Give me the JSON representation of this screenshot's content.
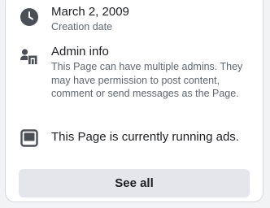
{
  "page_info": {
    "creation": {
      "date": "March 2, 2009",
      "label": "Creation date",
      "icon": "clock-icon"
    },
    "admin": {
      "title": "Admin info",
      "description": "This Page can have multiple admins. They may have permission to post content, comment or send messages as the Page.",
      "icon": "admins-icon"
    },
    "ads": {
      "text": "This Page is currently running ads.",
      "icon": "ads-tablet-icon"
    },
    "see_all_label": "See all"
  },
  "colors": {
    "icon": "#4b4f56",
    "button_bg": "#e4e6eb",
    "secondary_text": "#606770"
  }
}
